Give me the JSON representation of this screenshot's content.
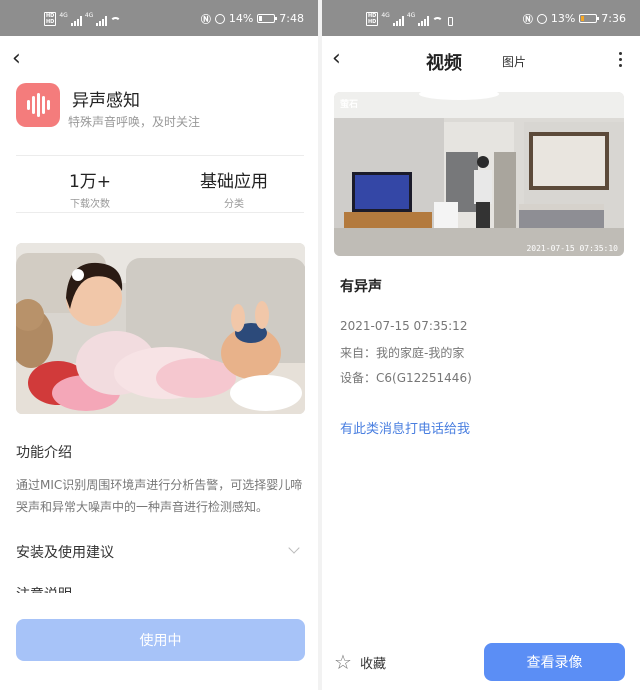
{
  "left": {
    "status": {
      "net1": "4G",
      "net2": "4G",
      "battery_pct": "14%",
      "time": "7:48"
    },
    "app": {
      "name": "异声感知",
      "subtitle": "特殊声音呼唤，及时关注"
    },
    "stats": [
      {
        "value": "1万+",
        "label": "下载次数"
      },
      {
        "value": "基础应用",
        "label": "分类"
      }
    ],
    "intro_title": "功能介绍",
    "intro_text": "通过MIC识别周围环境声进行分析告警，可选择婴儿啼哭声和异常大噪声中的一种声音进行检测感知。",
    "install_title": "安装及使用建议",
    "cut_section": "注意说明",
    "use_button": "使用中"
  },
  "right": {
    "status": {
      "net1": "4G",
      "net2": "4G",
      "battery_pct": "13%",
      "time": "7:36"
    },
    "tabs": {
      "video": "视频",
      "picture": "图片"
    },
    "camera": {
      "logo": "萤石",
      "timestamp": "2021-07-15 07:35:10"
    },
    "event": {
      "title": "有异声",
      "time": "2021-07-15 07:35:12",
      "from": "来自：我的家庭-我的家",
      "device": "设备：C6(G12251446)"
    },
    "call_link": "有此类消息打电话给我",
    "favorite_label": "收藏",
    "view_button": "查看录像"
  },
  "colors": {
    "accent": "#5b8ef5",
    "app_icon": "#f47c7c",
    "disabled_button": "#a7c3f8",
    "link": "#4a7fe0"
  }
}
